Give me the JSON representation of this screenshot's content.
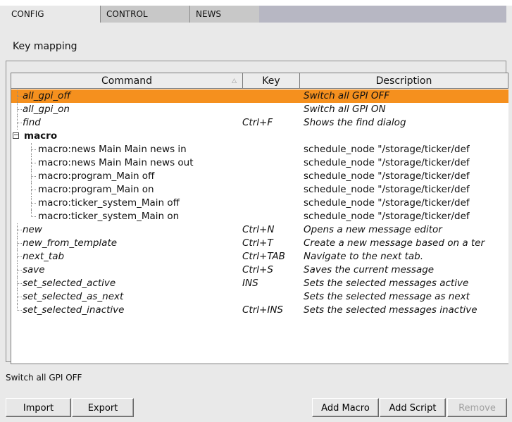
{
  "tabs": [
    {
      "label": "CONFIG",
      "active": true
    },
    {
      "label": "CONTROL",
      "active": false
    },
    {
      "label": "NEWS",
      "active": false
    }
  ],
  "page_title": "Key mapping",
  "table": {
    "columns": [
      "Command",
      "Key",
      "Description"
    ],
    "rows": [
      {
        "command": "all_gpi_off",
        "key": "",
        "description": "Switch all GPI OFF",
        "selected": true
      },
      {
        "command": "all_gpi_on",
        "key": "",
        "description": "Switch all GPI ON"
      },
      {
        "command": "find",
        "key": "Ctrl+F",
        "description": "Shows the find dialog"
      },
      {
        "command": "macro",
        "key": "",
        "description": "",
        "group": true,
        "expander": "−"
      },
      {
        "command": "macro:news Main Main news in",
        "key": "",
        "description": "schedule_node \"/storage/ticker/def"
      },
      {
        "command": "macro:news Main Main news out",
        "key": "",
        "description": "schedule_node \"/storage/ticker/def"
      },
      {
        "command": "macro:program_Main off",
        "key": "",
        "description": "schedule_node \"/storage/ticker/def"
      },
      {
        "command": "macro:program_Main on",
        "key": "",
        "description": "schedule_node \"/storage/ticker/def"
      },
      {
        "command": "macro:ticker_system_Main off",
        "key": "",
        "description": "schedule_node \"/storage/ticker/def"
      },
      {
        "command": "macro:ticker_system_Main on",
        "key": "",
        "description": "schedule_node \"/storage/ticker/def"
      },
      {
        "command": "new",
        "key": "Ctrl+N",
        "description": "Opens a new message editor"
      },
      {
        "command": "new_from_template",
        "key": "Ctrl+T",
        "description": "Create a new message based on a ter"
      },
      {
        "command": "next_tab",
        "key": "Ctrl+TAB",
        "description": "Navigate to the next tab."
      },
      {
        "command": "save",
        "key": "Ctrl+S",
        "description": "Saves the current message"
      },
      {
        "command": "set_selected_active",
        "key": "INS",
        "description": "Sets the selected messages active"
      },
      {
        "command": "set_selected_as_next",
        "key": "",
        "description": "Sets the selected message as next"
      },
      {
        "command": "set_selected_inactive",
        "key": "Ctrl+INS",
        "description": "Sets the selected messages inactive"
      }
    ]
  },
  "status_text": "Switch all GPI OFF",
  "buttons": {
    "import": "Import",
    "export": "Export",
    "add_macro": "Add Macro",
    "add_script": "Add Script",
    "remove": "Remove"
  },
  "colors": {
    "selection": "#f5901e",
    "tab_strip": "#b7b7c3"
  }
}
